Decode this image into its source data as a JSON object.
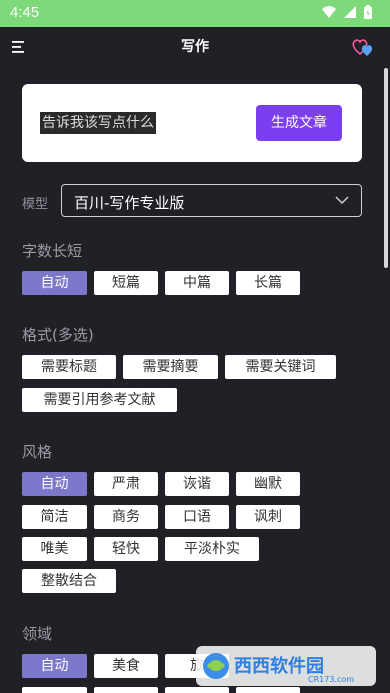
{
  "status_bar": {
    "time": "4:45"
  },
  "app_bar": {
    "title": "写作"
  },
  "prompt_card": {
    "placeholder": "告诉我该写点什么",
    "generate_label": "生成文章"
  },
  "model": {
    "label": "模型",
    "selected": "百川-写作专业版"
  },
  "sections": {
    "length": {
      "title": "字数长短",
      "options": [
        "自动",
        "短篇",
        "中篇",
        "长篇"
      ],
      "selected": "自动"
    },
    "format": {
      "title": "格式(多选)",
      "options": [
        "需要标题",
        "需要摘要",
        "需要关键词",
        "需要引用参考文献"
      ]
    },
    "style": {
      "title": "风格",
      "options": [
        "自动",
        "严肃",
        "诙谐",
        "幽默",
        "简洁",
        "商务",
        "口语",
        "讽刺",
        "唯美",
        "轻快",
        "平淡朴实",
        "整散结合"
      ],
      "selected": "自动"
    },
    "domain": {
      "title": "领域",
      "options": [
        "自动",
        "美食",
        "旅"
      ],
      "selected": "自动"
    }
  },
  "watermark": {
    "text": "西西软件园",
    "sub": "CR173.com"
  },
  "colors": {
    "status_bar": "#7ed97a",
    "background": "#202127",
    "accent": "#7c3ff0",
    "chip_selected": "#7b77c9"
  }
}
